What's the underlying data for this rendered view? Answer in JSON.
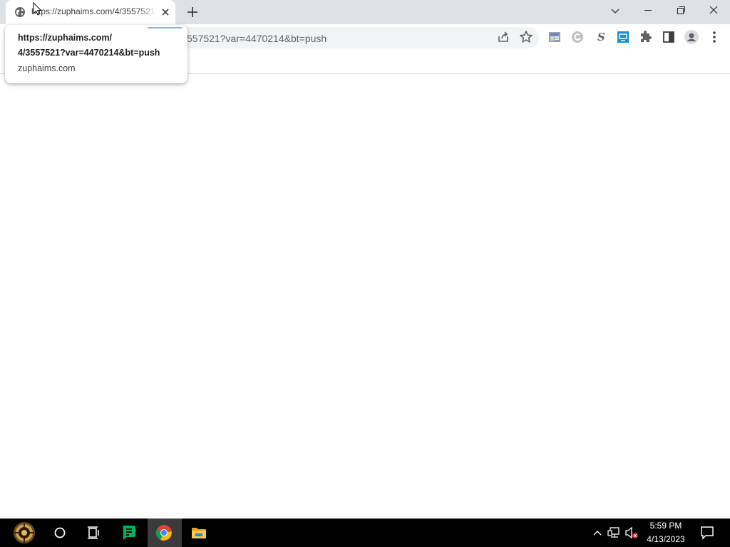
{
  "browser": {
    "tab": {
      "title": "https://zuphaims.com/4/3557521?var=4470214&bt=push",
      "favicon": "globe-icon"
    },
    "window_controls": [
      "tab-search-icon",
      "minimize-icon",
      "restore-icon",
      "close-icon"
    ],
    "toolbar": {
      "url_visible": "557521?var=4470214&bt=push",
      "icons": [
        "share-icon",
        "star-icon",
        "extension-news-icon",
        "extension-grammarly-icon",
        "extension-s-icon",
        "extension-blue-icon",
        "puzzle-icon",
        "side-panel-icon",
        "profile-icon",
        "menu-icon"
      ]
    },
    "hover_card": {
      "title_line_1": "https://zuphaims.com/",
      "title_line_2": "4/3557521?var=4470214&bt=push",
      "domain": "zuphaims.com"
    }
  },
  "taskbar": {
    "items": [
      "start-icon",
      "search-circle-icon",
      "task-view-icon",
      "green-app-icon",
      "chrome-icon",
      "file-explorer-icon"
    ],
    "tray_icons": [
      "chevron-up-icon",
      "network-icon",
      "volume-muted-icon",
      "notification-icon"
    ],
    "clock": {
      "time": "5:59 PM",
      "date": "4/13/2023"
    },
    "colors": {
      "background": "#000000",
      "active": "#3b3b3b",
      "accent": "#76b9ed"
    }
  }
}
